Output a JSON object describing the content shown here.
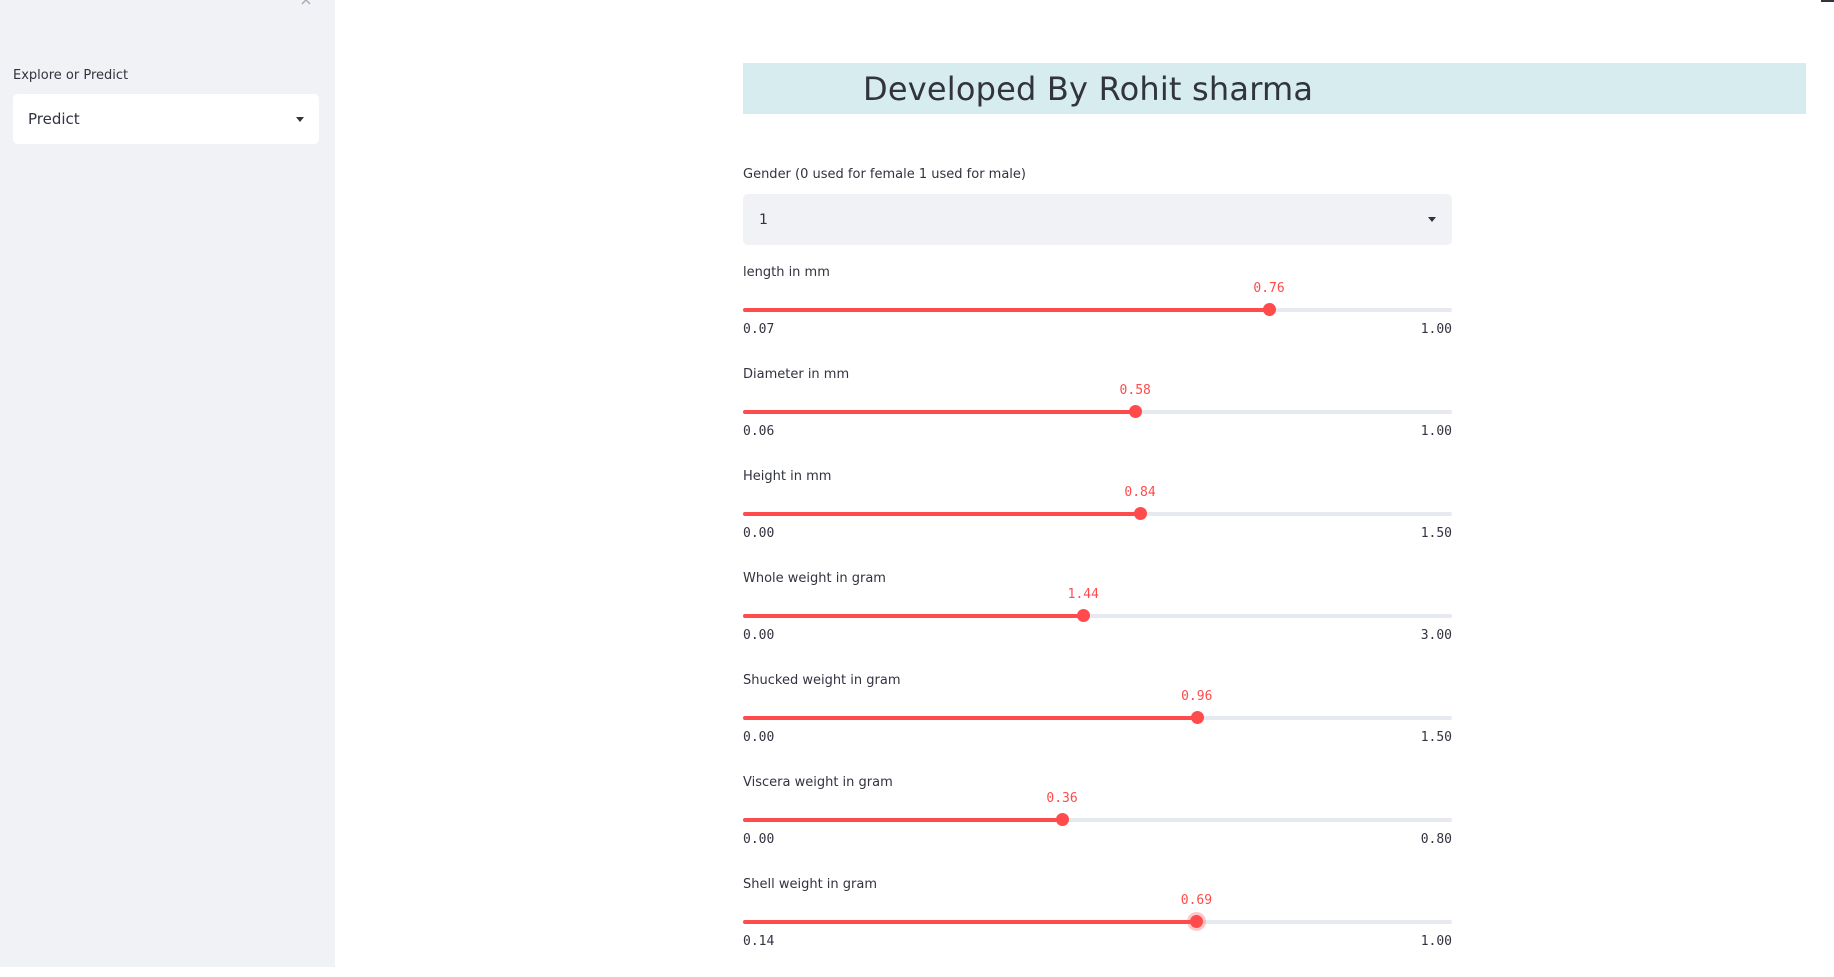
{
  "sidebar": {
    "close_glyph": "×",
    "mode_label": "Explore or Predict",
    "mode_value": "Predict"
  },
  "banner": {
    "title": "Developed By Rohit sharma"
  },
  "gender": {
    "label": "Gender (0 used for female 1 used for male)",
    "value": "1"
  },
  "sliders": [
    {
      "label": "length in mm",
      "value": 0.76,
      "value_text": "0.76",
      "min": 0.07,
      "min_text": "0.07",
      "max": 1.0,
      "max_text": "1.00"
    },
    {
      "label": "Diameter in mm",
      "value": 0.58,
      "value_text": "0.58",
      "min": 0.06,
      "min_text": "0.06",
      "max": 1.0,
      "max_text": "1.00"
    },
    {
      "label": "Height in mm",
      "value": 0.84,
      "value_text": "0.84",
      "min": 0.0,
      "min_text": "0.00",
      "max": 1.5,
      "max_text": "1.50"
    },
    {
      "label": "Whole weight in gram",
      "value": 1.44,
      "value_text": "1.44",
      "min": 0.0,
      "min_text": "0.00",
      "max": 3.0,
      "max_text": "3.00"
    },
    {
      "label": "Shucked weight in gram",
      "value": 0.96,
      "value_text": "0.96",
      "min": 0.0,
      "min_text": "0.00",
      "max": 1.5,
      "max_text": "1.50"
    },
    {
      "label": "Viscera weight in gram",
      "value": 0.36,
      "value_text": "0.36",
      "min": 0.0,
      "min_text": "0.00",
      "max": 0.8,
      "max_text": "0.80"
    },
    {
      "label": "Shell weight in gram",
      "value": 0.69,
      "value_text": "0.69",
      "min": 0.14,
      "min_text": "0.14",
      "max": 1.0,
      "max_text": "1.00",
      "active": true
    }
  ],
  "colors": {
    "accent": "#ff4b4b",
    "sidebar_bg": "#f0f2f6",
    "banner_bg": "#d6ecee",
    "text": "#31333f",
    "track": "#e6e9ef"
  },
  "icons": {
    "sidebar_close": "close-icon",
    "dropdown": "chevron-down-icon"
  }
}
